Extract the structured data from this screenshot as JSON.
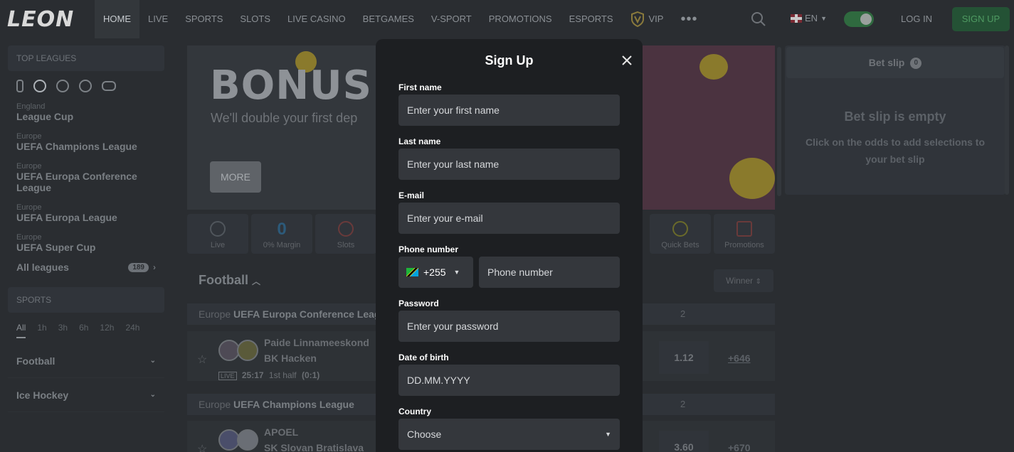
{
  "header": {
    "logo": "LEON",
    "nav": [
      "HOME",
      "LIVE",
      "SPORTS",
      "SLOTS",
      "LIVE CASINO",
      "BETGAMES",
      "V-SPORT",
      "PROMOTIONS",
      "ESPORTS",
      "VIP"
    ],
    "more": "•••",
    "language": "EN",
    "login": "LOG IN",
    "signup": "SIGN UP"
  },
  "sidebar": {
    "top_leagues_title": "TOP LEAGUES",
    "leagues": [
      {
        "region": "England",
        "name": "League Cup"
      },
      {
        "region": "Europe",
        "name": "UEFA Champions League"
      },
      {
        "region": "Europe",
        "name": "UEFA Europa Conference League"
      },
      {
        "region": "Europe",
        "name": "UEFA Europa League"
      },
      {
        "region": "Europe",
        "name": "UEFA Super Cup"
      }
    ],
    "all_leagues": "All leagues",
    "all_leagues_count": "189",
    "sports_title": "SPORTS",
    "time_filters": [
      "All",
      "1h",
      "3h",
      "6h",
      "12h",
      "24h"
    ],
    "sports": [
      "Football",
      "Ice Hockey"
    ]
  },
  "banner": {
    "title": "BONUS UP",
    "subtitle": "We'll double your first dep",
    "more": "MORE"
  },
  "tiles": [
    "Live",
    "0% Margin",
    "Slots",
    "Quick Bets",
    "Promotions"
  ],
  "tile_zero": "0",
  "events": {
    "heading": "Football",
    "market": "Winner",
    "competitions": [
      {
        "region": "Europe",
        "name": "UEFA Europa Conference League",
        "col": "2",
        "team1": "Paide Linnameeskond",
        "team2": "BK Hacken",
        "live_tag": "LIVE",
        "time": "25:17",
        "period": "1st half",
        "score": "(0:1)",
        "odd": "1.12",
        "more": "+646"
      },
      {
        "region": "Europe",
        "name": "UEFA Champions League",
        "col": "2",
        "team1": "APOEL",
        "team2": "SK Slovan Bratislava",
        "odd": "3.60",
        "more": "+670"
      }
    ]
  },
  "betslip": {
    "tab": "Bet slip",
    "count": "0",
    "empty_title": "Bet slip is empty",
    "empty_text": "Click on the odds to add selections to your bet slip"
  },
  "modal": {
    "title": "Sign Up",
    "first_name_label": "First name",
    "first_name_placeholder": "Enter your first name",
    "last_name_label": "Last name",
    "last_name_placeholder": "Enter your last name",
    "email_label": "E-mail",
    "email_placeholder": "Enter your e-mail",
    "phone_label": "Phone number",
    "phone_code": "+255",
    "phone_placeholder": "Phone number",
    "password_label": "Password",
    "password_placeholder": "Enter your password",
    "dob_label": "Date of birth",
    "dob_placeholder": "DD.MM.YYYY",
    "country_label": "Country",
    "country_value": "Choose"
  },
  "colors": {
    "modal_bg": "#1d1f22",
    "input_bg": "#34373c",
    "signup_green": "#245235"
  }
}
